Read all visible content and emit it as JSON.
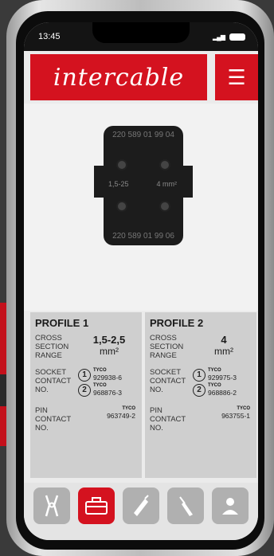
{
  "status": {
    "time": "13:45"
  },
  "header": {
    "logo": "intercable",
    "menu_icon": "hamburger-icon"
  },
  "hero": {
    "top_text": "220 589 01 99 04",
    "bottom_text": "220 589 01 99 06",
    "left_text": "1,5-25",
    "right_text": "4 mm²"
  },
  "profiles": [
    {
      "title": "PROFILE 1",
      "cross_label": "CROSS SECTION RANGE",
      "cross_value": "1,5-2,5",
      "cross_unit": "mm²",
      "socket_label": "SOCKET CONTACT NO.",
      "socket": [
        {
          "idx": "1",
          "brand": "TYCO",
          "num": "929938-6"
        },
        {
          "idx": "2",
          "brand": "TYCO",
          "num": "968876-3"
        }
      ],
      "pin_label": "PIN CONTACT NO.",
      "pin": {
        "brand": "TYCO",
        "num": "963749-2"
      }
    },
    {
      "title": "PROFILE 2",
      "cross_label": "CROSS SECTION RANGE",
      "cross_value": "4",
      "cross_unit": "mm²",
      "socket_label": "SOCKET CONTACT NO.",
      "socket": [
        {
          "idx": "1",
          "brand": "TYCO",
          "num": "929975-3"
        },
        {
          "idx": "2",
          "brand": "TYCO",
          "num": "968886-2"
        }
      ],
      "pin_label": "PIN CONTACT NO.",
      "pin": {
        "brand": "TYCO",
        "num": "963755-1"
      }
    }
  ],
  "tabs": [
    {
      "icon": "crimp-tool-icon",
      "active": false
    },
    {
      "icon": "toolbox-icon",
      "active": true
    },
    {
      "icon": "cable-icon",
      "active": false
    },
    {
      "icon": "screwdriver-icon",
      "active": false
    },
    {
      "icon": "user-icon",
      "active": false
    }
  ],
  "colors": {
    "brand": "#d4121f"
  }
}
